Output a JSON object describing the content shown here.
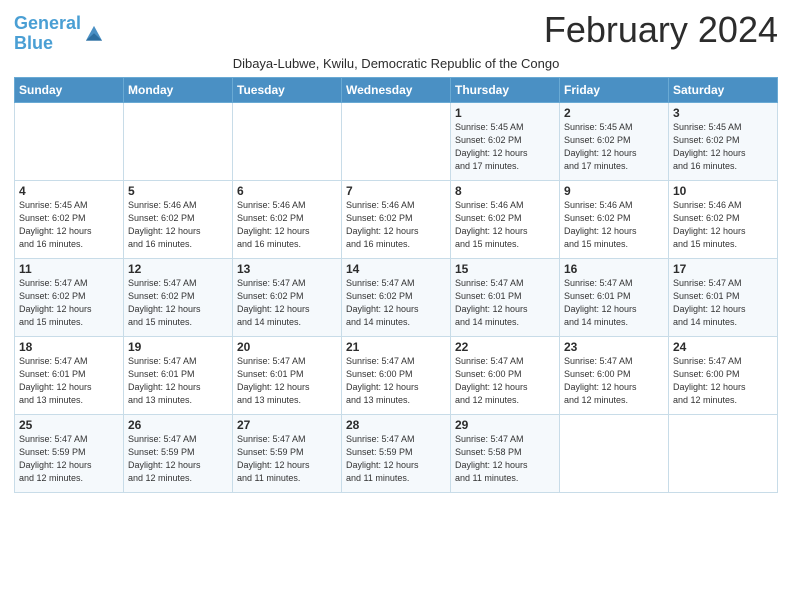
{
  "header": {
    "logo_line1": "General",
    "logo_line2": "Blue",
    "month_title": "February 2024",
    "subtitle": "Dibaya-Lubwe, Kwilu, Democratic Republic of the Congo"
  },
  "weekdays": [
    "Sunday",
    "Monday",
    "Tuesday",
    "Wednesday",
    "Thursday",
    "Friday",
    "Saturday"
  ],
  "weeks": [
    [
      {
        "day": "",
        "info": ""
      },
      {
        "day": "",
        "info": ""
      },
      {
        "day": "",
        "info": ""
      },
      {
        "day": "",
        "info": ""
      },
      {
        "day": "1",
        "info": "Sunrise: 5:45 AM\nSunset: 6:02 PM\nDaylight: 12 hours\nand 17 minutes."
      },
      {
        "day": "2",
        "info": "Sunrise: 5:45 AM\nSunset: 6:02 PM\nDaylight: 12 hours\nand 17 minutes."
      },
      {
        "day": "3",
        "info": "Sunrise: 5:45 AM\nSunset: 6:02 PM\nDaylight: 12 hours\nand 16 minutes."
      }
    ],
    [
      {
        "day": "4",
        "info": "Sunrise: 5:45 AM\nSunset: 6:02 PM\nDaylight: 12 hours\nand 16 minutes."
      },
      {
        "day": "5",
        "info": "Sunrise: 5:46 AM\nSunset: 6:02 PM\nDaylight: 12 hours\nand 16 minutes."
      },
      {
        "day": "6",
        "info": "Sunrise: 5:46 AM\nSunset: 6:02 PM\nDaylight: 12 hours\nand 16 minutes."
      },
      {
        "day": "7",
        "info": "Sunrise: 5:46 AM\nSunset: 6:02 PM\nDaylight: 12 hours\nand 16 minutes."
      },
      {
        "day": "8",
        "info": "Sunrise: 5:46 AM\nSunset: 6:02 PM\nDaylight: 12 hours\nand 15 minutes."
      },
      {
        "day": "9",
        "info": "Sunrise: 5:46 AM\nSunset: 6:02 PM\nDaylight: 12 hours\nand 15 minutes."
      },
      {
        "day": "10",
        "info": "Sunrise: 5:46 AM\nSunset: 6:02 PM\nDaylight: 12 hours\nand 15 minutes."
      }
    ],
    [
      {
        "day": "11",
        "info": "Sunrise: 5:47 AM\nSunset: 6:02 PM\nDaylight: 12 hours\nand 15 minutes."
      },
      {
        "day": "12",
        "info": "Sunrise: 5:47 AM\nSunset: 6:02 PM\nDaylight: 12 hours\nand 15 minutes."
      },
      {
        "day": "13",
        "info": "Sunrise: 5:47 AM\nSunset: 6:02 PM\nDaylight: 12 hours\nand 14 minutes."
      },
      {
        "day": "14",
        "info": "Sunrise: 5:47 AM\nSunset: 6:02 PM\nDaylight: 12 hours\nand 14 minutes."
      },
      {
        "day": "15",
        "info": "Sunrise: 5:47 AM\nSunset: 6:01 PM\nDaylight: 12 hours\nand 14 minutes."
      },
      {
        "day": "16",
        "info": "Sunrise: 5:47 AM\nSunset: 6:01 PM\nDaylight: 12 hours\nand 14 minutes."
      },
      {
        "day": "17",
        "info": "Sunrise: 5:47 AM\nSunset: 6:01 PM\nDaylight: 12 hours\nand 14 minutes."
      }
    ],
    [
      {
        "day": "18",
        "info": "Sunrise: 5:47 AM\nSunset: 6:01 PM\nDaylight: 12 hours\nand 13 minutes."
      },
      {
        "day": "19",
        "info": "Sunrise: 5:47 AM\nSunset: 6:01 PM\nDaylight: 12 hours\nand 13 minutes."
      },
      {
        "day": "20",
        "info": "Sunrise: 5:47 AM\nSunset: 6:01 PM\nDaylight: 12 hours\nand 13 minutes."
      },
      {
        "day": "21",
        "info": "Sunrise: 5:47 AM\nSunset: 6:00 PM\nDaylight: 12 hours\nand 13 minutes."
      },
      {
        "day": "22",
        "info": "Sunrise: 5:47 AM\nSunset: 6:00 PM\nDaylight: 12 hours\nand 12 minutes."
      },
      {
        "day": "23",
        "info": "Sunrise: 5:47 AM\nSunset: 6:00 PM\nDaylight: 12 hours\nand 12 minutes."
      },
      {
        "day": "24",
        "info": "Sunrise: 5:47 AM\nSunset: 6:00 PM\nDaylight: 12 hours\nand 12 minutes."
      }
    ],
    [
      {
        "day": "25",
        "info": "Sunrise: 5:47 AM\nSunset: 5:59 PM\nDaylight: 12 hours\nand 12 minutes."
      },
      {
        "day": "26",
        "info": "Sunrise: 5:47 AM\nSunset: 5:59 PM\nDaylight: 12 hours\nand 12 minutes."
      },
      {
        "day": "27",
        "info": "Sunrise: 5:47 AM\nSunset: 5:59 PM\nDaylight: 12 hours\nand 11 minutes."
      },
      {
        "day": "28",
        "info": "Sunrise: 5:47 AM\nSunset: 5:59 PM\nDaylight: 12 hours\nand 11 minutes."
      },
      {
        "day": "29",
        "info": "Sunrise: 5:47 AM\nSunset: 5:58 PM\nDaylight: 12 hours\nand 11 minutes."
      },
      {
        "day": "",
        "info": ""
      },
      {
        "day": "",
        "info": ""
      }
    ]
  ]
}
